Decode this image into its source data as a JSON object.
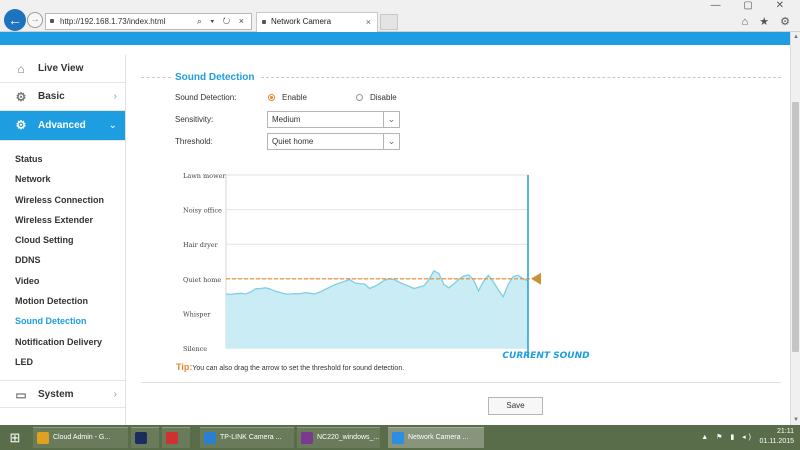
{
  "browser": {
    "url": "http://192.168.1.73/index.html",
    "tab_title": "Network Camera",
    "tab_close": "×",
    "nav_back": "←",
    "nav_forward": "→",
    "address_tools": "⌕ ▾ ↻ ×",
    "window_controls": "— ▢ ✕",
    "right_icons": "⌂ ★ ⚙"
  },
  "sidebar": {
    "live_view": "Live View",
    "basic": "Basic",
    "advanced": "Advanced",
    "submenu": [
      "Status",
      "Network",
      "Wireless Connection",
      "Wireless Extender",
      "Cloud Setting",
      "DDNS",
      "Video",
      "Motion Detection",
      "Sound Detection",
      "Notification Delivery",
      "LED"
    ],
    "current_submenu": "Sound Detection",
    "system": "System",
    "chevron_right": "›",
    "chevron_down": "⌄"
  },
  "section": {
    "title": "Sound Detection"
  },
  "form": {
    "sound_detection_label": "Sound Detection:",
    "enable_label": "Enable",
    "disable_label": "Disable",
    "enabled": true,
    "sensitivity_label": "Sensitivity:",
    "sensitivity_value": "Medium",
    "threshold_label": "Threshold:",
    "threshold_value": "Quiet home"
  },
  "chart_data": {
    "type": "area",
    "levels": [
      "Silence",
      "Whisper",
      "Quiet home",
      "Hair dryer",
      "Noisy office",
      "Lawn mower"
    ],
    "threshold_level": 2.0,
    "values": [
      1.56,
      1.55,
      1.57,
      1.58,
      1.56,
      1.62,
      1.71,
      1.72,
      1.74,
      1.7,
      1.64,
      1.6,
      1.56,
      1.56,
      1.57,
      1.57,
      1.6,
      1.58,
      1.56,
      1.62,
      1.69,
      1.76,
      1.83,
      1.88,
      1.93,
      1.98,
      1.88,
      1.86,
      1.85,
      1.72,
      1.78,
      1.86,
      1.96,
      2.0,
      1.98,
      1.9,
      1.84,
      1.78,
      1.72,
      1.76,
      1.8,
      1.98,
      2.23,
      2.15,
      1.84,
      1.74,
      1.85,
      1.98,
      2.08,
      2.11,
      1.97,
      1.65,
      1.92,
      2.1,
      1.92,
      1.68,
      1.48,
      1.84,
      2.06,
      2.1,
      2.0,
      1.94
    ],
    "current_sound_label": "CURRENT SOUND",
    "grid": true
  },
  "tip": {
    "label": "Tip:",
    "text": "You can also drag the arrow to set the threshold for sound detection."
  },
  "buttons": {
    "save": "Save"
  },
  "taskbar": {
    "tasks": [
      {
        "label": "Cloud Admin - G...",
        "color": "#e0a020"
      },
      {
        "label": "",
        "color": "#1b2d5c"
      },
      {
        "label": "",
        "color": "#d03030"
      },
      {
        "label": "TP-LINK Camera ...",
        "color": "#2a7fd0"
      },
      {
        "label": "NC220_windows_...",
        "color": "#7a3a90"
      },
      {
        "label": "Network Camera ...",
        "color": "#2a8fe0"
      }
    ],
    "time": "21:11",
    "date": "01.11.2015",
    "tray_icons": "▲ ⚑ ▮ ◂)"
  },
  "colors": {
    "accent": "#1e9ee0",
    "threshold": "#e8872c",
    "wave_fill": "#c9ecf5",
    "wave_stroke": "#7fcfe4"
  }
}
